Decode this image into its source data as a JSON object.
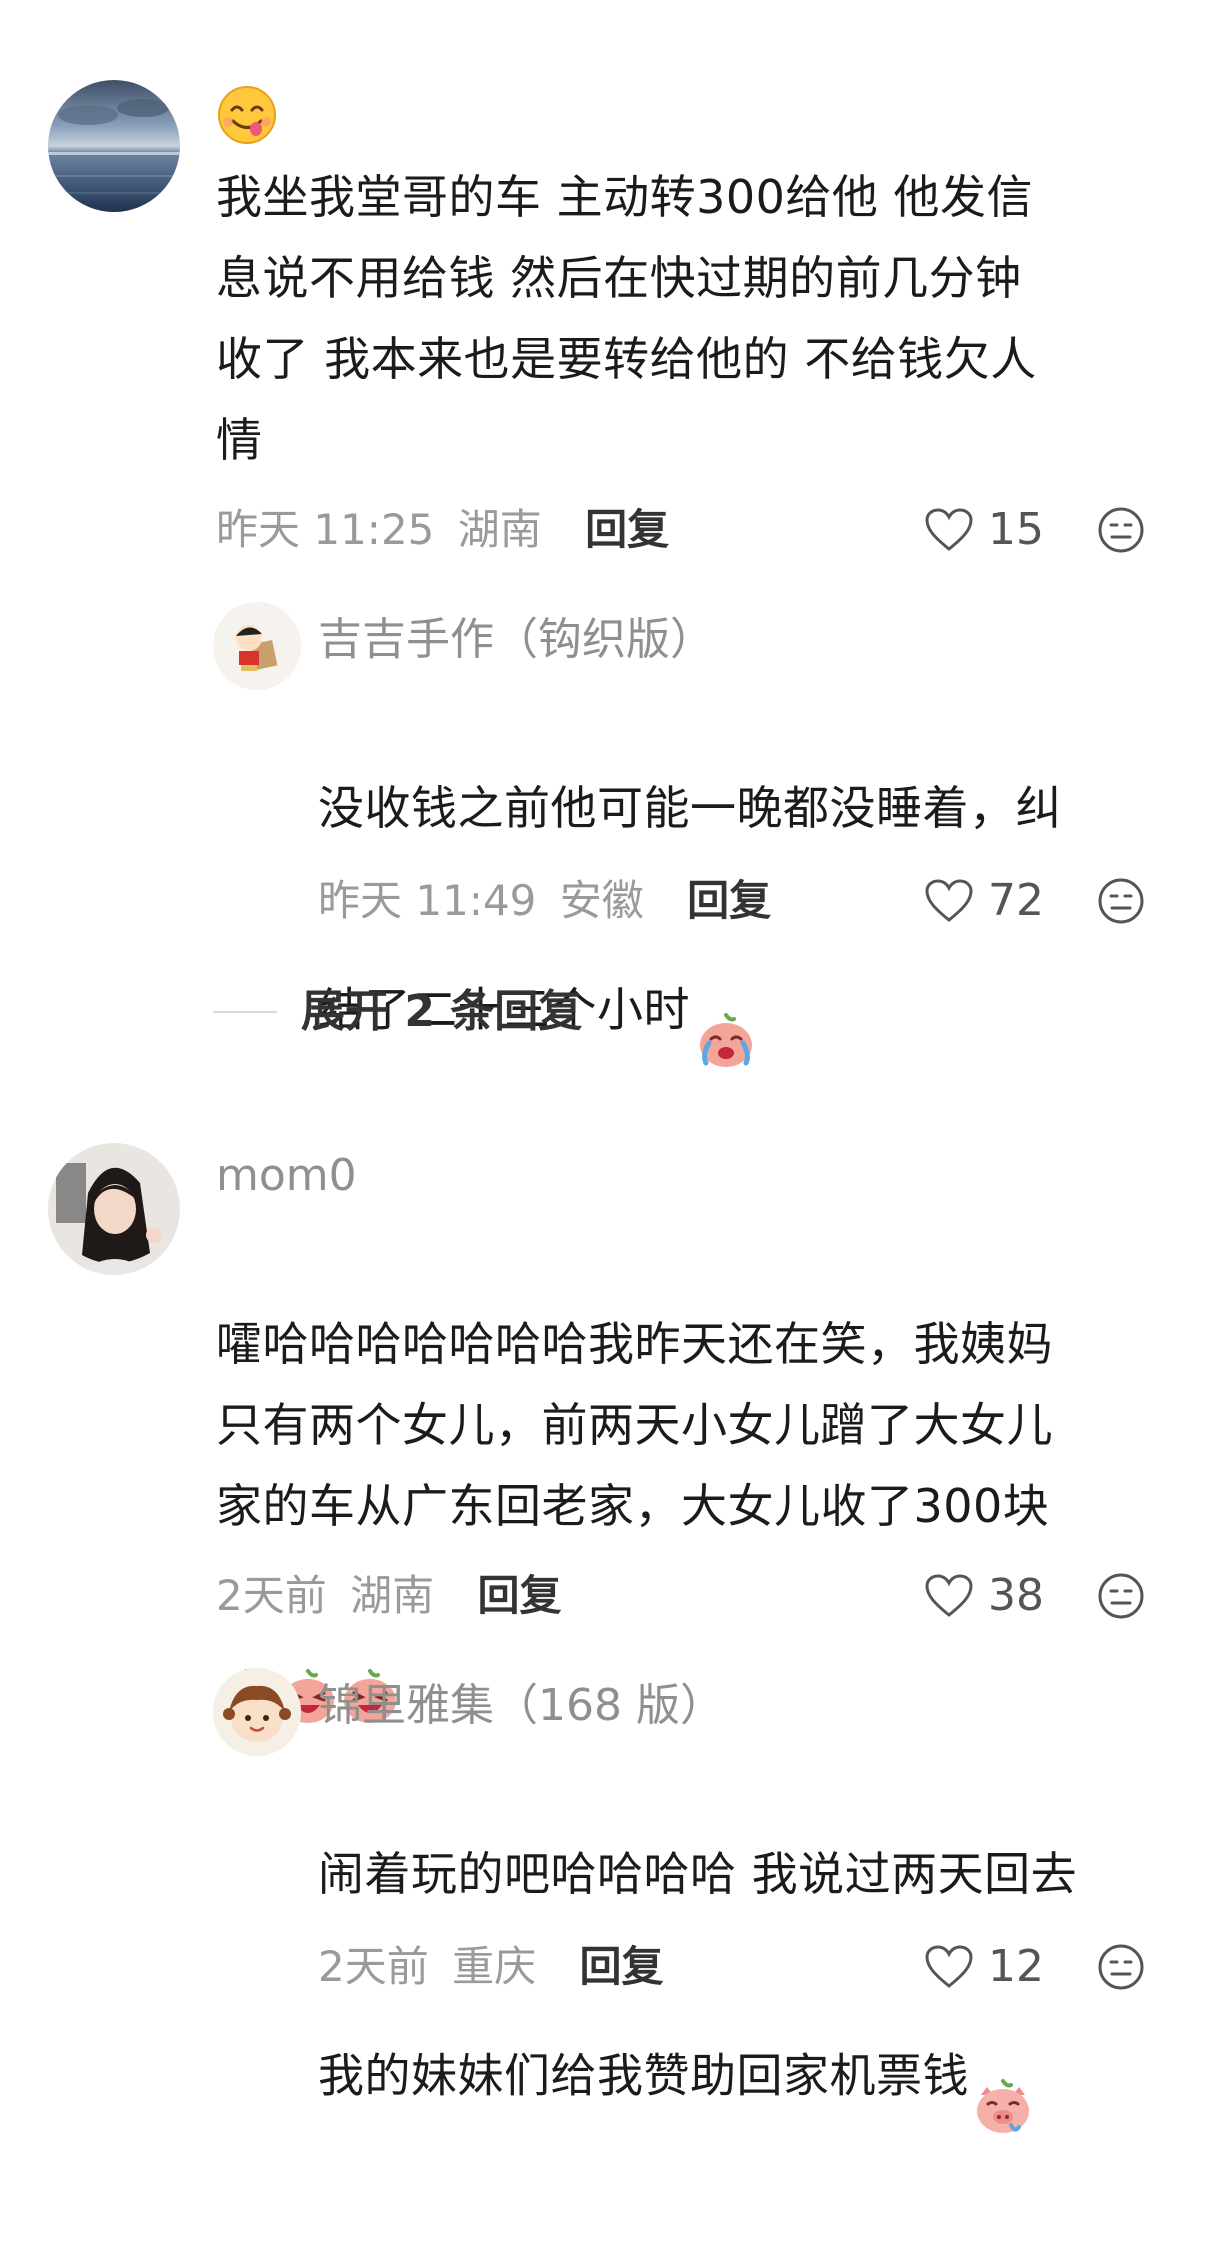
{
  "comments": [
    {
      "username": "",
      "emoji_name": "yummy-face-emoji",
      "text": "我坐我堂哥的车 主动转300给他 他发信\n息说不用给钱 然后在快过期的前几分钟\n收了 我本来也是要转给他的 不给钱欠人\n情",
      "time": "昨天 11:25",
      "location": "湖南",
      "reply_label": "回复",
      "likes": "15",
      "replies": [
        {
          "username": "吉吉手作（钩织版）",
          "text_line1": "没收钱之前他可能一晚都没睡着，纠",
          "text_line2": "结了二十三个小时",
          "time": "昨天 11:49",
          "location": "安徽",
          "reply_label": "回复",
          "likes": "72"
        }
      ],
      "expand_label": "展开 2 条回复"
    },
    {
      "username": "mom0",
      "text": "嚯哈哈哈哈哈哈哈我昨天还在笑，我姨妈\n只有两个女儿，前两天小女儿蹭了大女儿\n家的车从广东回老家，大女儿收了300块",
      "time": "2天前",
      "location": "湖南",
      "reply_label": "回复",
      "likes": "38",
      "replies": [
        {
          "username": "锦里雅集（168 版）",
          "text_line1": "闹着玩的吧哈哈哈哈 我说过两天回去",
          "text_line2": "我的妹妹们给我赞助回家机票钱",
          "time": "2天前",
          "location": "重庆",
          "reply_label": "回复",
          "likes": "12"
        }
      ]
    }
  ],
  "colors": {
    "text": "#1b1b1b",
    "meta": "#9a9a9a",
    "username": "#8f8f8f",
    "emoji_peach": "#f4a59a"
  }
}
